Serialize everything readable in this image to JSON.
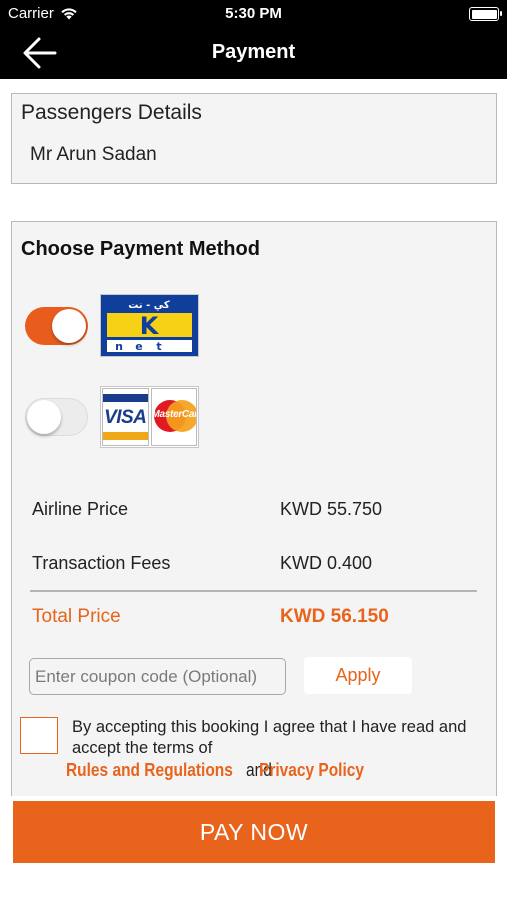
{
  "status_bar": {
    "carrier": "Carrier",
    "time": "5:30 PM"
  },
  "nav": {
    "title": "Payment",
    "back_icon": "arrow-left-icon"
  },
  "passengers": {
    "heading": "Passengers Details",
    "name": "Mr Arun Sadan"
  },
  "payment": {
    "heading": "Choose Payment Method",
    "methods": [
      {
        "name": "KNET",
        "selected": true
      },
      {
        "name": "VISA / MasterCard",
        "selected": false
      }
    ],
    "knet_logo_text": {
      "arabic": "كي - نت",
      "letters": [
        "K",
        "n",
        "e",
        "t"
      ]
    },
    "visa_text": "VISA",
    "mastercard_text": "MasterCard"
  },
  "prices": {
    "airline_label": "Airline Price",
    "airline_value": "KWD 55.750",
    "fees_label": "Transaction Fees",
    "fees_value": "KWD 0.400",
    "total_label": "Total Price",
    "total_value": "KWD 56.150"
  },
  "coupon": {
    "placeholder": "Enter coupon code (Optional)",
    "value": "",
    "apply_label": "Apply"
  },
  "terms": {
    "text": "By accepting this booking I agree that I have read and accept the terms of",
    "rules_link": "Rules and Regulations",
    "and": "and",
    "privacy_link": "Privacy Policy",
    "checked": false
  },
  "pay_button": "PAY NOW",
  "colors": {
    "accent": "#e8641c",
    "header": "#000000",
    "card_bg": "#f4f4f4"
  }
}
